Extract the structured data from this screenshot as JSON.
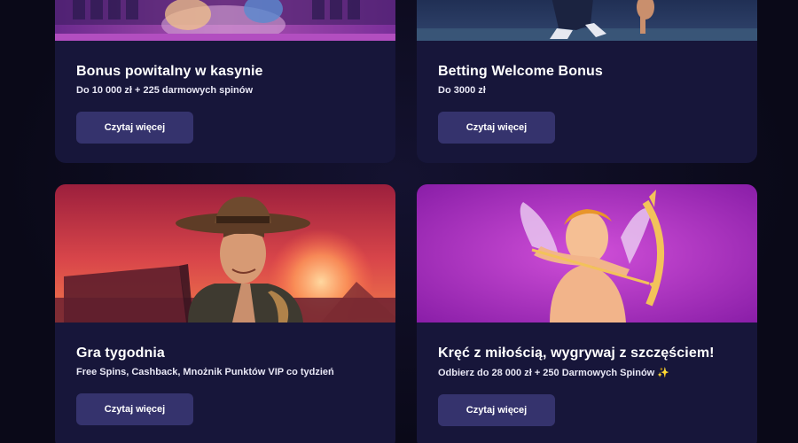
{
  "cards": [
    {
      "title": "Bonus powitalny w kasynie",
      "subtitle": "Do 10 000 zł + 225 darmowych spinów",
      "button_label": "Czytaj więcej"
    },
    {
      "title": "Betting Welcome Bonus",
      "subtitle": "Do 3000 zł",
      "button_label": "Czytaj więcej"
    },
    {
      "title": "Gra tygodnia",
      "subtitle": "Free Spins, Cashback, Mnożnik Punktów VIP co tydzień",
      "button_label": "Czytaj więcej"
    },
    {
      "title": "Kręć z miłością, wygrywaj z szczęściem!",
      "subtitle": "Odbierz do 28 000 zł + 250 Darmowych Spinów ✨",
      "button_label": "Czytaj więcej"
    }
  ],
  "colors": {
    "page_background": "#0b0a1a",
    "card_background": "#17163a",
    "button_background": "#35336d"
  }
}
